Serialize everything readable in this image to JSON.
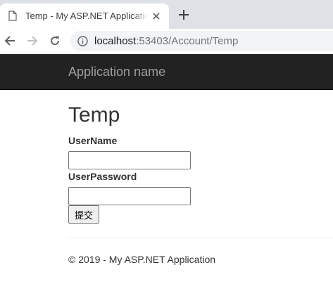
{
  "browser": {
    "tab_title": "Temp - My ASP.NET Application",
    "url_host": "localhost",
    "url_rest": ":53403/Account/Temp"
  },
  "navbar": {
    "brand": "Application name"
  },
  "form": {
    "heading": "Temp",
    "username_label": "UserName",
    "username_value": "",
    "password_label": "UserPassword",
    "password_value": "",
    "submit_label": "提交"
  },
  "footer": {
    "text": "© 2019 - My ASP.NET Application"
  }
}
